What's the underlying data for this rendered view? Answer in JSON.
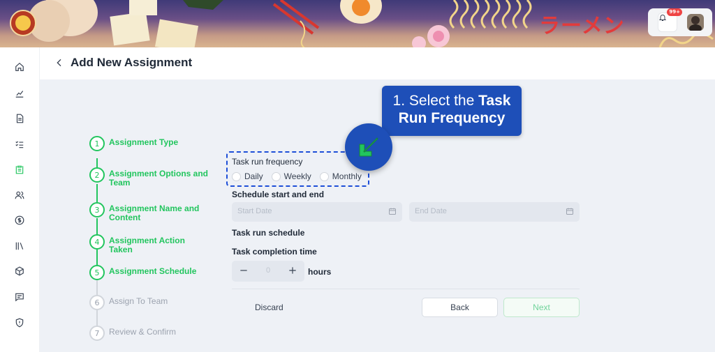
{
  "banner": {
    "brand_text": "ラーメン",
    "notification_count": "99+"
  },
  "header": {
    "title": "Add New Assignment"
  },
  "sidebar": {
    "items": [
      {
        "name": "home-icon"
      },
      {
        "name": "analytics-icon"
      },
      {
        "name": "document-icon"
      },
      {
        "name": "checklist-icon"
      },
      {
        "name": "clipboard-icon"
      },
      {
        "name": "users-icon"
      },
      {
        "name": "dollar-icon"
      },
      {
        "name": "library-icon"
      },
      {
        "name": "box-icon"
      },
      {
        "name": "chat-icon"
      },
      {
        "name": "shield-icon"
      }
    ]
  },
  "steps": [
    {
      "number": "1",
      "label": "Assignment Type",
      "status": "done"
    },
    {
      "number": "2",
      "label": "Assignment Options and Team",
      "status": "done"
    },
    {
      "number": "3",
      "label": "Assignment Name and Content",
      "status": "done"
    },
    {
      "number": "4",
      "label": "Assignment Action Taken",
      "status": "done"
    },
    {
      "number": "5",
      "label": "Assignment Schedule",
      "status": "active"
    },
    {
      "number": "6",
      "label": "Assign To Team",
      "status": "pending"
    },
    {
      "number": "7",
      "label": "Review & Confirm",
      "status": "pending"
    }
  ],
  "form": {
    "frequency_label": "Task run frequency",
    "frequency_options": [
      "Daily",
      "Weekly",
      "Monthly"
    ],
    "schedule_label": "Schedule start and end",
    "start_placeholder": "Start Date",
    "end_placeholder": "End Date",
    "run_schedule_label": "Task run schedule",
    "completion_label": "Task completion time",
    "completion_value": "0",
    "completion_unit": "hours"
  },
  "actions": {
    "discard": "Discard",
    "back": "Back",
    "next": "Next"
  },
  "callout": {
    "line1_prefix": "1. Select the ",
    "line1_bold": "Task",
    "line2_bold": "Run Frequency"
  },
  "colors": {
    "accent_green": "#22c55e",
    "callout_blue": "#1e4fb8",
    "background": "#eef1f6"
  }
}
